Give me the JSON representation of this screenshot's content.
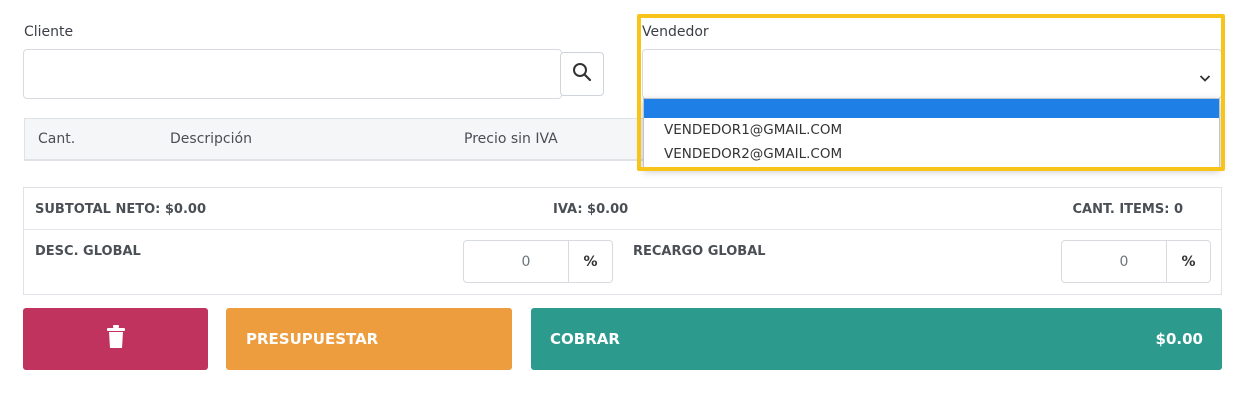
{
  "cliente": {
    "label": "Cliente",
    "value": ""
  },
  "vendedor": {
    "label": "Vendedor",
    "selected": "",
    "options": [
      "",
      "VENDEDOR1@GMAIL.COM",
      "VENDEDOR2@GMAIL.COM"
    ]
  },
  "table": {
    "headers": [
      "Cant.",
      "Descripción",
      "Precio sin IVA"
    ]
  },
  "totals": {
    "subtotal": "SUBTOTAL NETO: $0.00",
    "iva": "IVA: $0.00",
    "items": "CANT. ITEMS: 0",
    "desc_label": "DESC. GLOBAL",
    "desc_value": "0",
    "desc_unit": "%",
    "recargo_label": "RECARGO GLOBAL",
    "recargo_value": "0",
    "recargo_unit": "%"
  },
  "actions": {
    "presupuestar": "PRESUPUESTAR",
    "cobrar": "COBRAR",
    "cobrar_amount": "$0.00"
  },
  "colors": {
    "delete": "#c0335e",
    "presupuestar": "#ee9d3e",
    "cobrar": "#2d9a8e",
    "highlight": "#f7c519",
    "option_selected": "#1e7fe6"
  },
  "icons": [
    "search-icon",
    "trash-icon",
    "chevron-down-icon"
  ]
}
